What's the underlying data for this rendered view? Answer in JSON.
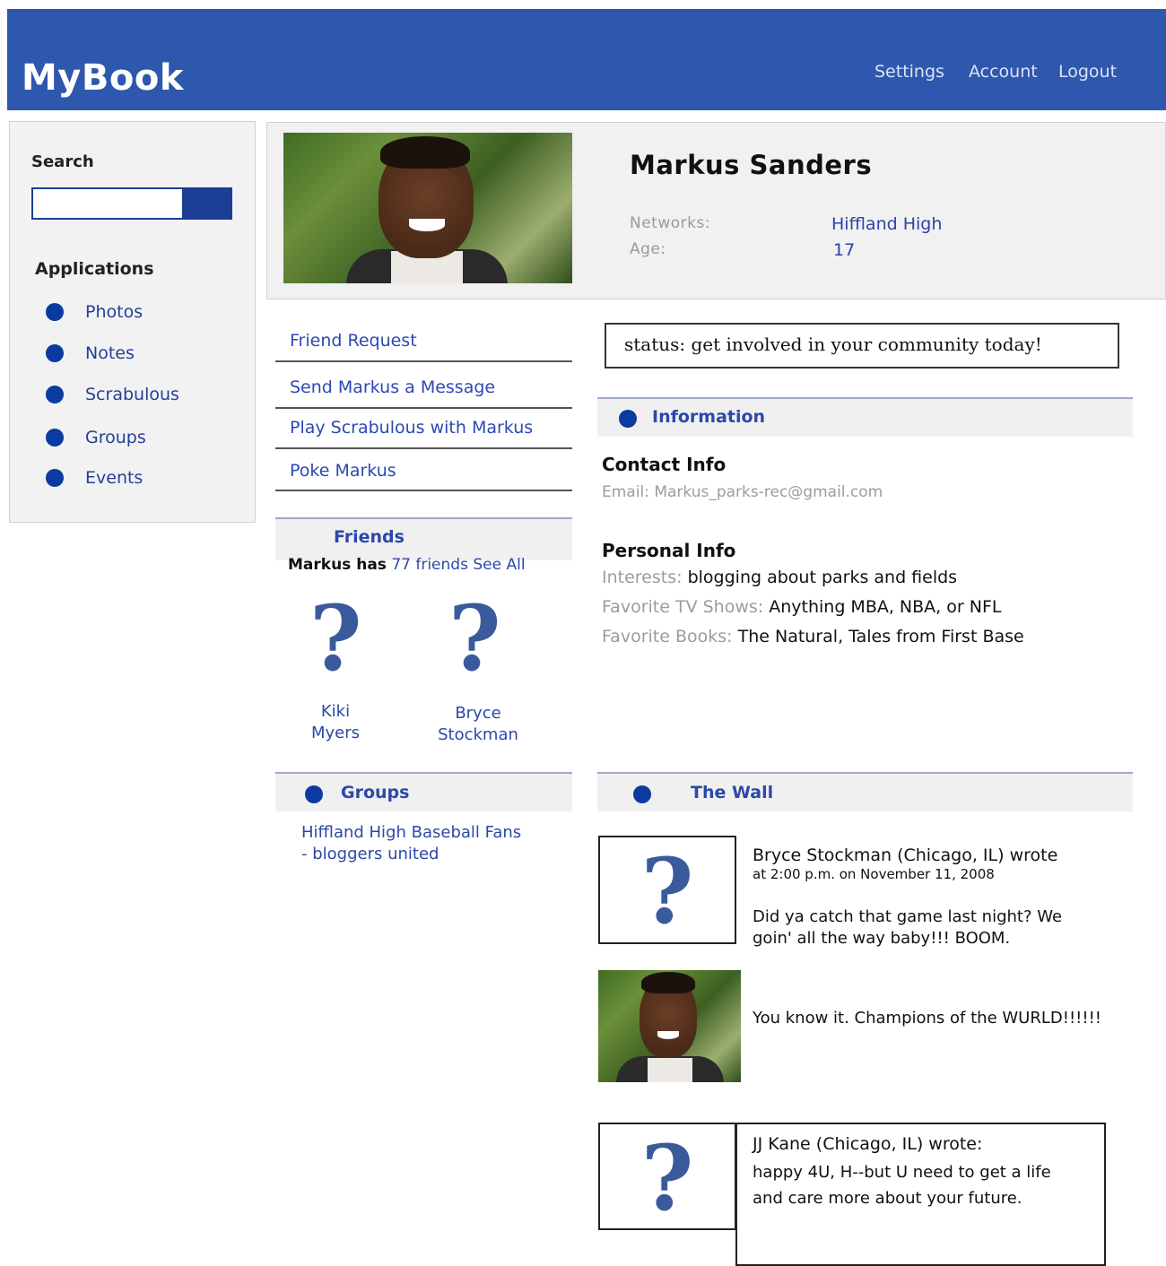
{
  "header": {
    "logo": "MyBook",
    "links": {
      "settings": "Settings",
      "account": "Account",
      "logout": "Logout"
    }
  },
  "sidebar": {
    "search_label": "Search",
    "applications_label": "Applications",
    "apps": [
      "Photos",
      "Notes",
      "Scrabulous",
      "Groups",
      "Events"
    ]
  },
  "profile": {
    "name": "Markus Sanders",
    "networks_label": "Networks:",
    "networks_value": "Hiffland High",
    "age_label": "Age:",
    "age_value": "17"
  },
  "actions": [
    "Friend Request",
    "Send Markus a Message",
    "Play Scrabulous with Markus",
    "Poke Markus"
  ],
  "status": "status: get involved in your community today!",
  "friends": {
    "title": "Friends",
    "summary_prefix": "Markus has",
    "count_text": "77 friends",
    "see_all": "See All",
    "list": [
      {
        "first": "Kiki",
        "last": "Myers"
      },
      {
        "first": "Bryce",
        "last": "Stockman"
      }
    ]
  },
  "groups": {
    "title": "Groups",
    "items": [
      "Hiffland High Baseball Fans",
      "- bloggers united"
    ]
  },
  "information": {
    "title": "Information",
    "contact_heading": "Contact Info",
    "email_label": "Email:",
    "email_value": "Markus_parks-rec@gmail.com",
    "personal_heading": "Personal Info",
    "interests_label": "Interests:",
    "interests_value": "blogging about parks and fields",
    "tv_label": "Favorite TV Shows:",
    "tv_value": "Anything MBA, NBA, or NFL",
    "books_label": "Favorite Books:",
    "books_value": "The Natural, Tales from First Base"
  },
  "wall": {
    "title": "The Wall",
    "posts": [
      {
        "author": "Bryce Stockman (Chicago, IL) wrote",
        "time": "at 2:00 p.m. on November 11, 2008",
        "line1": "Did ya catch that game last night? We",
        "line2": "goin' all the way baby!!! BOOM."
      },
      {
        "line1": "You know it. Champions of the WURLD!!!!!!"
      },
      {
        "author": "JJ Kane (Chicago, IL) wrote:",
        "line1": "happy 4U, H--but U need to get a life",
        "line2": "and care more about your future."
      }
    ]
  },
  "placeholder_glyph": "?"
}
